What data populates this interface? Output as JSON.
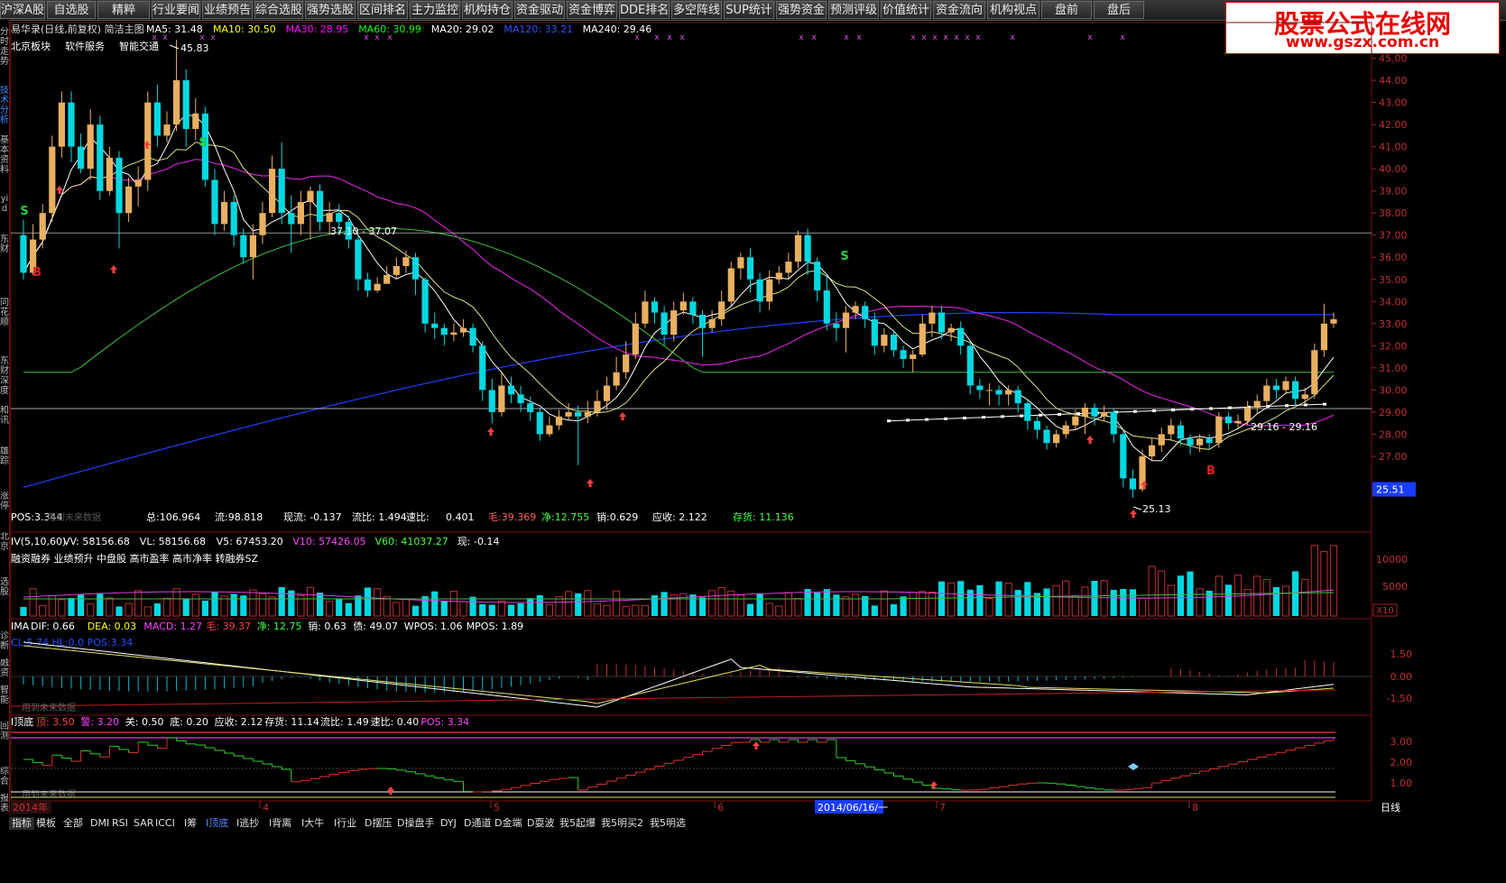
{
  "toolbar": {
    "buttons": [
      "沪深A股",
      "自选股",
      "精粹",
      "行业要闻",
      "业绩预告",
      "综合选股",
      "强势选股",
      "区间排名",
      "主力监控",
      "机构持仓",
      "资金驱动",
      "资金博弈",
      "DDE排名",
      "多空阵线",
      "SUP统计",
      "强势资金",
      "预测评级",
      "价值统计",
      "资金流向",
      "机构视点",
      "盘前",
      "盘后"
    ]
  },
  "logo": {
    "line1": "股票公式在线网",
    "line2": "www.gszx.com.cn"
  },
  "left_tabs": [
    "分时走势",
    "技术分析",
    "基本资料",
    "yi d",
    "东财",
    "同花顺",
    "东财深度",
    "和讯",
    "雄踪",
    "涨停",
    "北京",
    "选股",
    "诊断",
    "融资",
    "智能",
    "回测",
    "综合",
    "报表"
  ],
  "main_header": {
    "stock": "易华录(日线,前复权) 简洁主图",
    "ma_items": [
      {
        "text": "MA5: 31.48",
        "color": "#ffffff"
      },
      {
        "text": "MA10: 30.50",
        "color": "#ffff00"
      },
      {
        "text": "MA30: 28.95",
        "color": "#ff00ff"
      },
      {
        "text": "MA60: 30.99",
        "color": "#00ff00"
      },
      {
        "text": "MA20: 29.02",
        "color": "#ffffff"
      },
      {
        "text": "MA120: 33.21",
        "color": "#3050ff"
      },
      {
        "text": "MA240: 29.46",
        "color": "#ffffff"
      }
    ],
    "concepts": [
      "北京板块",
      "软件服务",
      "智能交通"
    ]
  },
  "main_stats": {
    "pos": "POS:3.344",
    "overlay": "用到未来数据",
    "total": "总:106.964",
    "float": "流:98.818",
    "cashflow": "现流: -0.137",
    "current_ratio": "流比: 1.494",
    "quick_ratio_label": "速比:",
    "quick_ratio": "0.401",
    "gross": "毛:39.369",
    "net": "净:12.755",
    "sales": "销:0.629",
    "receivable": "应收: 2.122",
    "inventory": "存货: 11.136"
  },
  "price_axis": [
    "45.00",
    "44.00",
    "43.00",
    "42.00",
    "41.00",
    "40.00",
    "39.00",
    "38.00",
    "37.00",
    "36.00",
    "35.00",
    "34.00",
    "33.00",
    "32.00",
    "31.00",
    "30.00",
    "29.00",
    "28.00",
    "27.00"
  ],
  "last_price": "25.51",
  "annotations": {
    "high": "45.83",
    "low": "25.13",
    "level1": "37.10 - 37.07",
    "level2": "29.16 - 29.16"
  },
  "vol_panel": {
    "header": "IV(5,10,60)",
    "items": [
      {
        "text": "VV: 58156.68",
        "color": "#ffffff"
      },
      {
        "text": "VL: 58156.68",
        "color": "#ffffff"
      },
      {
        "text": "V5: 67453.20",
        "color": "#ffffff"
      },
      {
        "text": "V10: 57426.05",
        "color": "#ff44ff"
      },
      {
        "text": "V60: 41037.27",
        "color": "#44ff44"
      },
      {
        "text": "现: -0.14",
        "color": "#ffffff"
      }
    ],
    "tags": "融资融券 业绩预升 中盘股 高市盈率 高市净率 转融券SZ",
    "axis": [
      "10000",
      "5000"
    ],
    "unit": "X10"
  },
  "macd_panel": {
    "header": "IMA",
    "items": [
      {
        "text": "DIF: 0.66",
        "color": "#ffffff"
      },
      {
        "text": "DEA: 0.03",
        "color": "#ffff00"
      },
      {
        "text": "MACD: 1.27",
        "color": "#ff44ff"
      },
      {
        "text": "毛: 39.37",
        "color": "#ff4444"
      },
      {
        "text": "净: 12.75",
        "color": "#44ff44"
      },
      {
        "text": "销: 0.63",
        "color": "#ffffff"
      },
      {
        "text": "债: 49.07",
        "color": "#ffffff"
      },
      {
        "text": "WPOS: 1.06",
        "color": "#ffffff"
      },
      {
        "text": "MPOS: 1.89",
        "color": "#ffffff"
      }
    ],
    "line2": "CL:5.74 HL:0.0 POS:3.34",
    "overlay": "用到未来数据",
    "axis": [
      "1.50",
      "0.00",
      "-1.50"
    ]
  },
  "top_panel": {
    "header": "I顶底",
    "items": [
      {
        "text": "顶: 3.50",
        "color": "#ff4444"
      },
      {
        "text": "警: 3.20",
        "color": "#ff44ff"
      },
      {
        "text": "关: 0.50",
        "color": "#ffffff"
      },
      {
        "text": "底: 0.20",
        "color": "#ffffff"
      },
      {
        "text": "应收: 2.12",
        "color": "#ffffff"
      },
      {
        "text": "存货: 11.14",
        "color": "#ffffff"
      },
      {
        "text": "流比: 1.49",
        "color": "#ffffff"
      },
      {
        "text": "速比: 0.40",
        "color": "#ffffff"
      },
      {
        "text": "POS: 3.34",
        "color": "#ff44ff"
      }
    ],
    "overlay": "用到未来数据",
    "axis": [
      "3.00",
      "2.00",
      "1.00"
    ]
  },
  "date_axis": {
    "year": "2014年",
    "months": [
      "4",
      "5",
      "6",
      "7",
      "8"
    ],
    "cursor_date": "2014/06/16/一"
  },
  "bottom_tabs": [
    "指标",
    "模板",
    "全部",
    "DMI",
    "RSI",
    "SAR",
    "ICCI",
    "I筹",
    "I顶底",
    "I逃抄",
    "I背离",
    "I大牛",
    "I行业",
    "D摆压",
    "D操盘手",
    "DYJ",
    "D通道",
    "D金端",
    "D耍波",
    "我5起爆",
    "我5明买2",
    "我5明选"
  ],
  "period_label": "日线",
  "chart_data": {
    "type": "candlestick",
    "title": "易华录(日线,前复权)",
    "ylim": [
      25.13,
      45.83
    ],
    "series": [
      {
        "name": "MA5",
        "value_last": 31.48
      },
      {
        "name": "MA10",
        "value_last": 30.5
      },
      {
        "name": "MA30",
        "value_last": 28.95
      },
      {
        "name": "MA60",
        "value_last": 30.99
      },
      {
        "name": "MA120",
        "value_last": 33.21
      },
      {
        "name": "MA240",
        "value_last": 29.46
      }
    ],
    "highest": 45.83,
    "lowest": 25.13,
    "last": 25.51,
    "candles": [
      [
        37.0,
        35.3,
        37.7,
        35.0
      ],
      [
        35.3,
        36.8,
        37.5,
        35.2
      ],
      [
        36.8,
        38.0,
        38.4,
        36.4
      ],
      [
        38.0,
        41.0,
        41.5,
        37.6
      ],
      [
        41.0,
        43.0,
        43.5,
        40.5
      ],
      [
        43.0,
        41.0,
        43.5,
        40.3
      ],
      [
        41.0,
        40.0,
        41.6,
        39.8
      ],
      [
        40.0,
        42.0,
        42.7,
        39.5
      ],
      [
        42.0,
        39.0,
        42.4,
        38.6
      ],
      [
        39.0,
        40.5,
        41.0,
        38.8
      ],
      [
        40.5,
        38.0,
        40.8,
        36.4
      ],
      [
        38.0,
        39.2,
        39.6,
        37.6
      ],
      [
        39.2,
        39.5,
        40.1,
        38.3
      ],
      [
        39.5,
        43.0,
        43.5,
        39.0
      ],
      [
        43.0,
        41.5,
        43.8,
        41.0
      ],
      [
        41.5,
        42.0,
        42.6,
        41.2
      ],
      [
        42.0,
        44.0,
        45.83,
        41.7
      ],
      [
        44.0,
        41.8,
        44.5,
        41.0
      ],
      [
        41.8,
        42.5,
        43.2,
        41.3
      ],
      [
        42.5,
        39.5,
        42.8,
        39.2
      ],
      [
        39.5,
        37.5,
        40.0,
        37.0
      ],
      [
        37.5,
        38.5,
        39.0,
        37.2
      ],
      [
        38.5,
        37.0,
        38.8,
        36.5
      ],
      [
        37.0,
        36.0,
        37.3,
        35.7
      ],
      [
        36.0,
        37.0,
        37.5,
        35.0
      ],
      [
        37.0,
        38.0,
        38.5,
        36.6
      ],
      [
        38.0,
        40.0,
        40.6,
        37.8
      ],
      [
        40.0,
        38.0,
        41.2,
        37.5
      ],
      [
        38.0,
        37.5,
        38.8,
        36.2
      ],
      [
        37.5,
        38.5,
        39.0,
        37.0
      ],
      [
        38.5,
        39.0,
        39.2,
        36.8
      ],
      [
        39.0,
        37.6,
        39.3,
        37.2
      ],
      [
        37.6,
        38.0,
        38.5,
        37.0
      ],
      [
        38.0,
        37.6,
        38.4,
        37.0
      ],
      [
        37.6,
        36.8,
        37.9,
        36.4
      ],
      [
        36.8,
        35.0,
        37.0,
        34.5
      ],
      [
        35.0,
        34.5,
        35.3,
        34.2
      ],
      [
        34.5,
        34.8,
        35.1,
        34.4
      ],
      [
        34.8,
        35.2,
        35.6,
        34.9
      ],
      [
        35.2,
        35.6,
        36.0,
        35.0
      ],
      [
        35.6,
        36.0,
        36.3,
        35.3
      ],
      [
        36.0,
        35.0,
        36.2,
        34.3
      ],
      [
        35.0,
        33.0,
        35.1,
        32.6
      ],
      [
        33.0,
        32.8,
        33.5,
        32.3
      ],
      [
        32.8,
        32.5,
        33.0,
        32.0
      ],
      [
        32.5,
        32.6,
        33.0,
        32.2
      ],
      [
        32.6,
        32.8,
        33.2,
        32.4
      ],
      [
        32.8,
        32.0,
        33.0,
        31.7
      ],
      [
        32.0,
        30.0,
        32.2,
        29.5
      ],
      [
        30.0,
        29.0,
        30.5,
        28.5
      ],
      [
        29.0,
        30.2,
        30.8,
        28.8
      ],
      [
        30.2,
        29.8,
        30.6,
        29.4
      ],
      [
        29.8,
        29.4,
        30.2,
        29.0
      ],
      [
        29.4,
        29.0,
        29.7,
        28.6
      ],
      [
        29.0,
        28.0,
        29.2,
        27.7
      ],
      [
        28.0,
        28.4,
        28.8,
        27.9
      ],
      [
        28.4,
        28.8,
        29.1,
        28.2
      ],
      [
        28.8,
        29.0,
        29.4,
        28.6
      ],
      [
        29.0,
        28.8,
        29.3,
        26.6
      ],
      [
        28.8,
        29.0,
        29.5,
        28.5
      ],
      [
        29.0,
        29.5,
        30.0,
        28.8
      ],
      [
        29.5,
        30.2,
        30.6,
        29.1
      ],
      [
        30.2,
        30.8,
        31.5,
        30.0
      ],
      [
        30.8,
        31.6,
        32.2,
        30.5
      ],
      [
        31.6,
        33.0,
        33.5,
        31.4
      ],
      [
        33.0,
        34.0,
        34.5,
        32.8
      ],
      [
        34.0,
        33.5,
        34.2,
        33.0
      ],
      [
        33.5,
        32.5,
        33.8,
        32.0
      ],
      [
        32.5,
        33.6,
        34.0,
        32.2
      ],
      [
        33.6,
        34.0,
        34.4,
        33.4
      ],
      [
        34.0,
        33.4,
        34.2,
        33.0
      ],
      [
        33.4,
        32.8,
        33.6,
        31.5
      ],
      [
        32.8,
        33.2,
        33.6,
        32.6
      ],
      [
        33.2,
        34.0,
        34.5,
        32.9
      ],
      [
        34.0,
        35.5,
        35.8,
        33.8
      ],
      [
        35.5,
        36.0,
        36.2,
        35.0
      ],
      [
        36.0,
        35.0,
        36.4,
        34.4
      ],
      [
        35.0,
        34.0,
        35.3,
        33.5
      ],
      [
        34.0,
        35.0,
        35.4,
        33.6
      ],
      [
        35.0,
        35.3,
        35.6,
        34.8
      ],
      [
        35.3,
        35.8,
        36.2,
        35.0
      ],
      [
        35.8,
        37.0,
        37.2,
        35.5
      ],
      [
        37.0,
        35.8,
        37.3,
        35.2
      ],
      [
        35.8,
        34.5,
        36.0,
        34.0
      ],
      [
        34.5,
        33.0,
        35.2,
        32.7
      ],
      [
        33.0,
        32.8,
        33.5,
        32.2
      ],
      [
        32.8,
        33.5,
        33.8,
        31.7
      ],
      [
        33.5,
        33.8,
        34.0,
        33.2
      ],
      [
        33.8,
        33.2,
        34.0,
        32.8
      ],
      [
        33.2,
        32.0,
        33.5,
        31.6
      ],
      [
        32.0,
        32.5,
        32.8,
        31.7
      ],
      [
        32.5,
        31.8,
        32.7,
        31.5
      ],
      [
        31.8,
        31.4,
        32.0,
        31.0
      ],
      [
        31.4,
        31.6,
        31.8,
        30.8
      ],
      [
        31.6,
        33.0,
        33.4,
        31.5
      ],
      [
        33.0,
        33.5,
        33.8,
        32.4
      ],
      [
        33.5,
        32.6,
        33.8,
        32.3
      ],
      [
        32.6,
        32.8,
        33.0,
        32.2
      ],
      [
        32.8,
        32.0,
        33.1,
        31.6
      ],
      [
        32.0,
        30.2,
        32.2,
        29.8
      ],
      [
        30.2,
        30.0,
        30.5,
        29.6
      ],
      [
        30.0,
        30.0,
        30.3,
        29.3
      ],
      [
        30.0,
        29.8,
        30.2,
        29.3
      ],
      [
        29.8,
        30.0,
        30.2,
        29.3
      ],
      [
        30.0,
        29.4,
        30.2,
        29.0
      ],
      [
        29.4,
        28.6,
        29.6,
        28.2
      ],
      [
        28.6,
        28.2,
        28.8,
        27.8
      ],
      [
        28.2,
        27.6,
        28.4,
        27.3
      ],
      [
        27.6,
        28.0,
        28.2,
        27.4
      ],
      [
        28.0,
        28.4,
        28.6,
        27.8
      ],
      [
        28.4,
        28.8,
        29.1,
        28.2
      ],
      [
        28.8,
        29.2,
        29.4,
        28.0
      ],
      [
        29.2,
        28.8,
        29.4,
        28.4
      ],
      [
        28.8,
        29.0,
        29.3,
        28.6
      ],
      [
        29.0,
        28.0,
        29.2,
        27.6
      ],
      [
        28.0,
        26.0,
        28.2,
        25.6
      ],
      [
        26.0,
        25.51,
        26.4,
        25.13
      ],
      [
        25.51,
        27.0,
        27.3,
        25.4
      ],
      [
        27.0,
        27.5,
        27.8,
        26.8
      ],
      [
        27.5,
        28.0,
        28.3,
        27.2
      ],
      [
        28.0,
        28.4,
        28.7,
        27.7
      ],
      [
        28.4,
        27.8,
        28.6,
        27.5
      ],
      [
        27.8,
        27.5,
        28.0,
        27.1
      ],
      [
        27.5,
        27.8,
        28.0,
        27.2
      ],
      [
        27.8,
        27.6,
        28.0,
        27.3
      ],
      [
        27.6,
        28.8,
        29.0,
        27.4
      ],
      [
        28.8,
        28.5,
        29.0,
        28.2
      ],
      [
        28.5,
        28.6,
        28.9,
        28.2
      ],
      [
        28.6,
        29.2,
        29.5,
        28.4
      ],
      [
        29.2,
        29.5,
        29.8,
        28.9
      ],
      [
        29.5,
        30.2,
        30.5,
        29.2
      ],
      [
        30.2,
        30.0,
        30.5,
        29.6
      ],
      [
        30.0,
        30.4,
        30.6,
        29.8
      ],
      [
        30.4,
        29.6,
        30.6,
        29.3
      ],
      [
        29.6,
        29.8,
        30.1,
        29.4
      ],
      [
        29.8,
        31.8,
        32.1,
        29.6
      ],
      [
        31.8,
        33.0,
        33.9,
        31.5
      ],
      [
        33.0,
        33.2,
        33.5,
        32.8
      ]
    ]
  }
}
